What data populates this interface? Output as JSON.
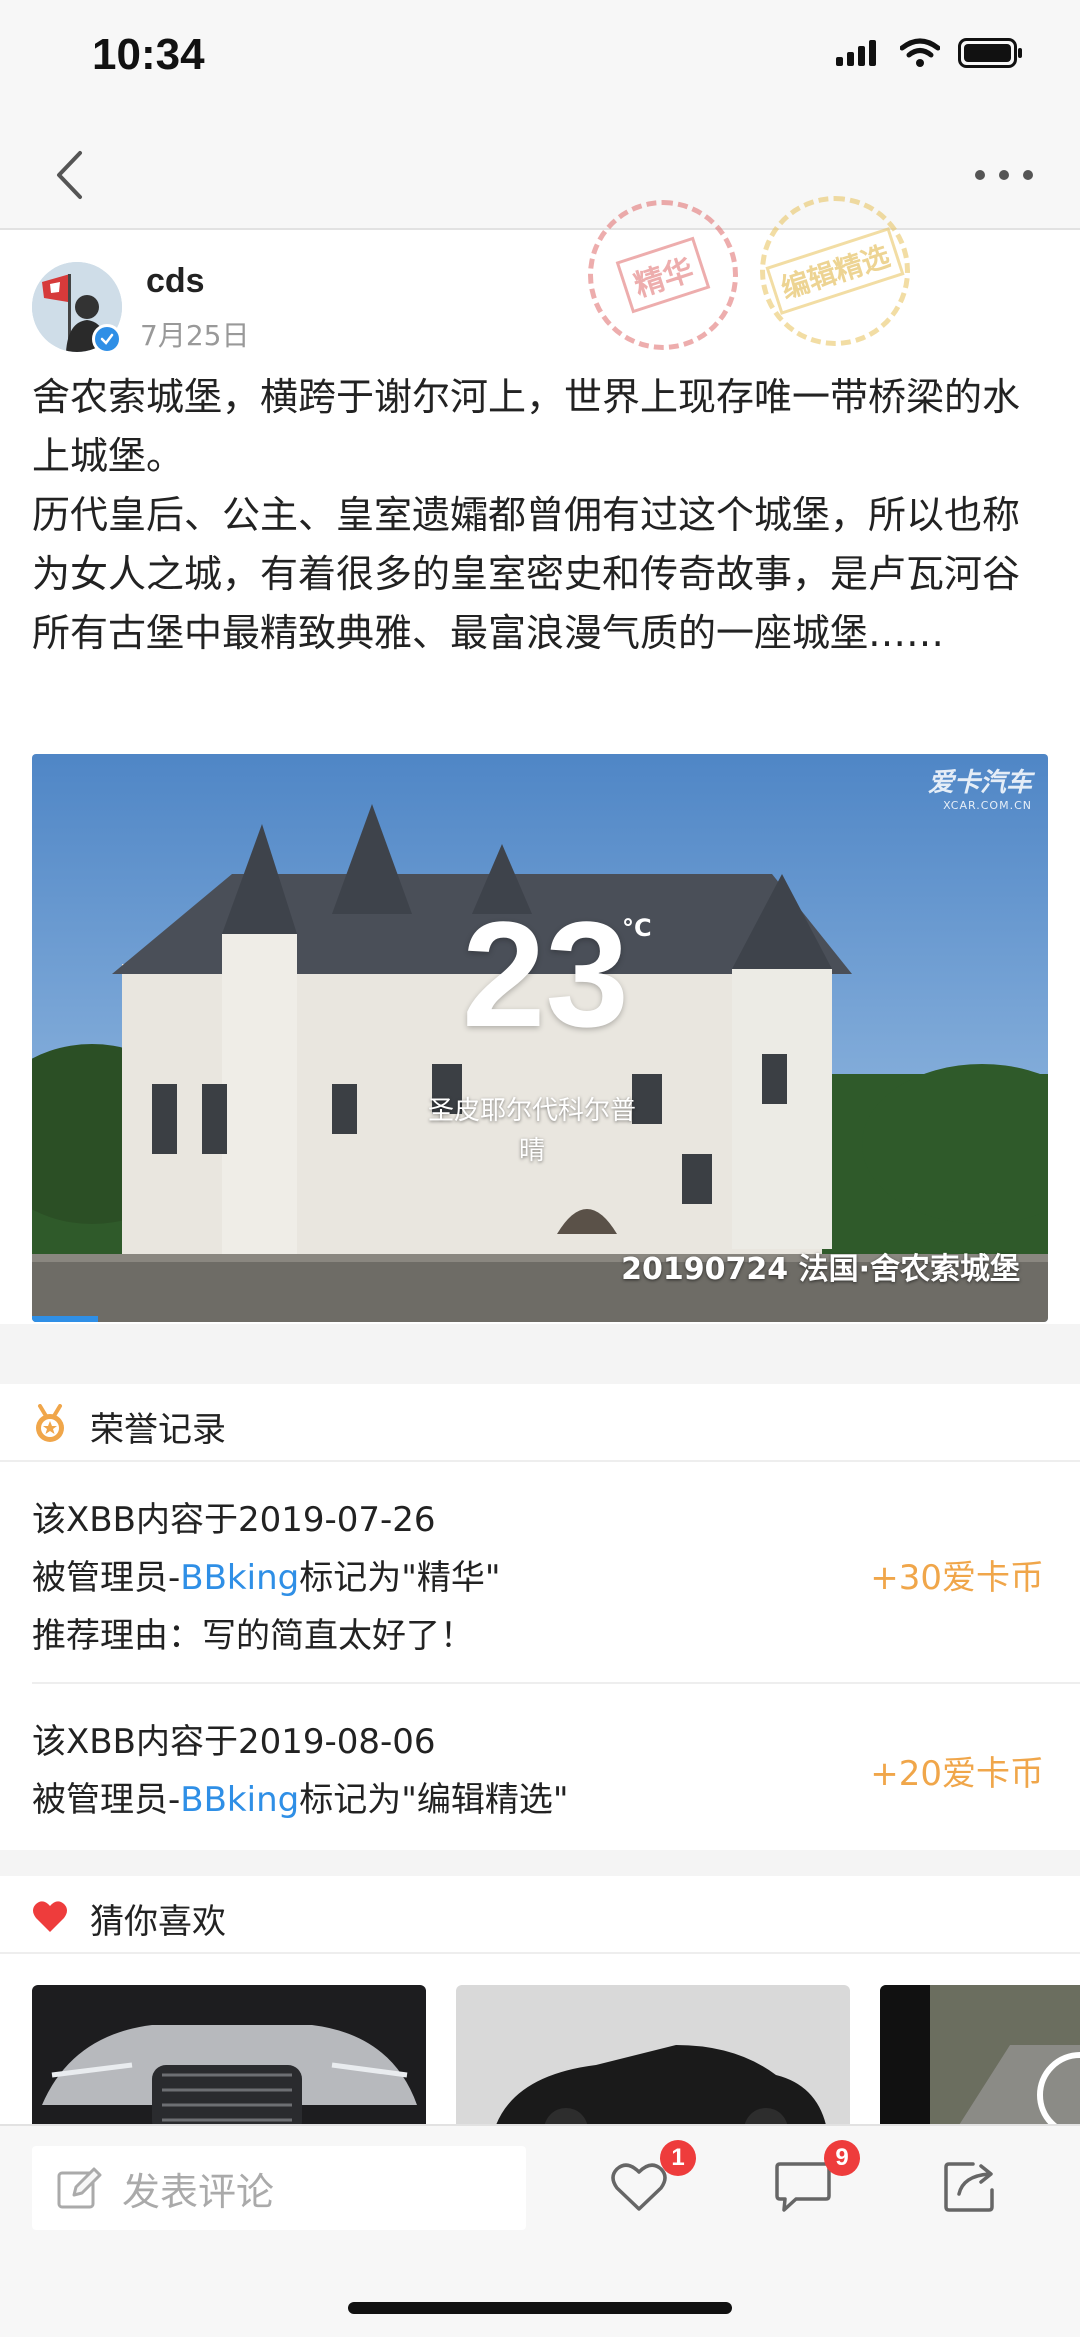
{
  "status_bar": {
    "time": "10:34"
  },
  "post": {
    "author": "cds",
    "date": "7月25日",
    "stamps": {
      "essence": "精华",
      "editor_pick": "编辑精选"
    },
    "paragraphs": [
      "舍农索城堡，横跨于谢尔河上，世界上现存唯一带桥梁的水上城堡。",
      "历代皇后、公主、皇室遗孀都曾佣有过这个城堡，所以也称为女人之城，有着很多的皇室密史和传奇故事，是卢瓦河谷所有古堡中最精致典雅、最富浪漫气质的一座城堡……"
    ]
  },
  "video": {
    "watermark": "爱卡汽车",
    "watermark_sub": "XCAR.COM.CN",
    "temperature": "23",
    "temp_unit": "°C",
    "city": "圣皮耶尔代科尔普",
    "weather": "晴",
    "caption": "20190724 法国·舍农索城堡",
    "progress": 0.065
  },
  "honor": {
    "title": "荣誉记录",
    "items": [
      {
        "line1": "该XBB内容于2019-07-26",
        "prefix": "被管理员-",
        "admin": "BBking",
        "suffix": "标记为\"精华\"",
        "reason": "推荐理由：写的简直太好了！",
        "reward": "+30爱卡币"
      },
      {
        "line1": "该XBB内容于2019-08-06",
        "prefix": "被管理员-",
        "admin": "BBking",
        "suffix": "标记为\"编辑精选\"",
        "reward": "+20爱卡币"
      }
    ]
  },
  "recommend": {
    "title": "猜你喜欢"
  },
  "bottom_bar": {
    "comment_placeholder": "发表评论",
    "like_count": "1",
    "comment_count": "9"
  },
  "colors": {
    "accent_blue": "#2f8fe6",
    "reward_orange": "#f0a64a",
    "badge_red": "#ee3c3c",
    "heart_red": "#ee3c3c"
  }
}
